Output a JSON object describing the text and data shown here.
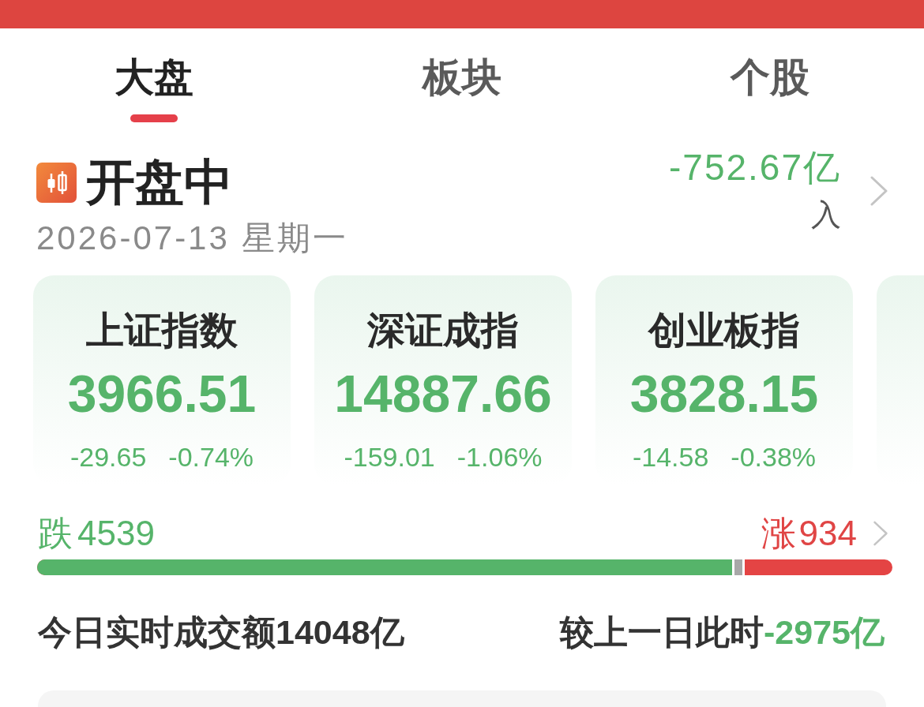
{
  "tabs": [
    {
      "label": "大盘",
      "selected": true
    },
    {
      "label": "板块",
      "selected": false
    },
    {
      "label": "个股",
      "selected": false
    }
  ],
  "market_status": {
    "label": "开盘中",
    "date": "2026-07-13 星期一",
    "net_flow": "-752.67亿",
    "flow_caption": "入"
  },
  "indices": [
    {
      "name": "上证指数",
      "value": "3966.51",
      "change": "-29.65",
      "change_pct": "-0.74%"
    },
    {
      "name": "深证成指",
      "value": "14887.66",
      "change": "-159.01",
      "change_pct": "-1.06%"
    },
    {
      "name": "创业板指",
      "value": "3828.15",
      "change": "-14.58",
      "change_pct": "-0.38%"
    }
  ],
  "breadth": {
    "fall_label": "跌",
    "fall_count": "4539",
    "rise_label": "涨",
    "rise_count": "934",
    "level": 0.813
  },
  "turnover": {
    "label": "今日实时成交额",
    "value": "14048亿",
    "compare_label": "较上一日此时",
    "compare_value": "-2975亿"
  }
}
